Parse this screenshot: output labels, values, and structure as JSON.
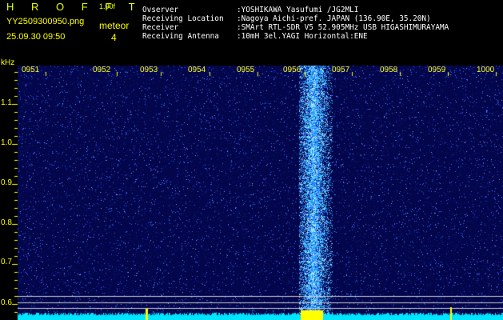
{
  "header": {
    "brand": "H R O F F T",
    "version": "1.00f",
    "filename": "YY2509300950.png",
    "timestamp": "25.09.30 09:50",
    "mode_label": "meteor",
    "mode_count": "4"
  },
  "info": [
    {
      "label": "Ovserver",
      "value": ":YOSHIKAWA Yasufumi /JG2MLI"
    },
    {
      "label": "Receiving Location",
      "value": ":Nagoya Aichi-pref. JAPAN (136.90E, 35.20N)"
    },
    {
      "label": "Receiver",
      "value": ":SMArt RTL-SDR V5 52.905MHz USB HIGASHIMURAYAMA"
    },
    {
      "label": "Receiving Antenna",
      "value": ":10mH 3el.YAGI Horizontal:ENE"
    }
  ],
  "axes": {
    "y_unit": "kHz",
    "time_labels": [
      "0951",
      "0952",
      "0953",
      "0954",
      "0955",
      "0956",
      "0957",
      "0958",
      "0959",
      "1000"
    ],
    "freq_labels": [
      "1.1",
      "1.0",
      "0.9",
      "0.8",
      "0.7",
      "0.6"
    ]
  },
  "colors": {
    "label": "#ffff00",
    "text": "#ffffff",
    "background": "#000000",
    "noise_dark": "#03064a",
    "noise_light": "#3a64ff",
    "carrier": "#2ec3ff",
    "baseline": "#00e5ff",
    "marker": "#ffff00"
  }
}
